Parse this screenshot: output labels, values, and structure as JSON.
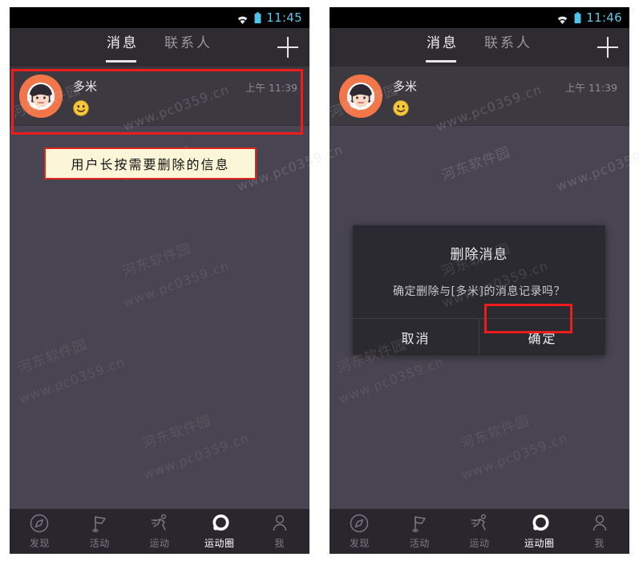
{
  "app": {
    "background_color": "#484451",
    "header_color": "#2e2b31",
    "accent_highlight_color": "#ee1d1d",
    "status_time_color": "#5ec8e8"
  },
  "panels": [
    {
      "id": "left",
      "statusbar": {
        "time": "11:45",
        "wifi_icon": "wifi-icon",
        "battery_icon": "battery-icon"
      },
      "header": {
        "tabs": [
          {
            "label": "消息",
            "active": true
          },
          {
            "label": "联系人",
            "active": false
          }
        ],
        "add_button": "+"
      },
      "messages": [
        {
          "avatar_icon": "avatar-support-girl-icon",
          "name": "多米",
          "preview_icon": "smiley-emoji-icon",
          "time": "上午 11:39"
        }
      ],
      "annotation": {
        "text": "用户长按需要删除的信息",
        "border_color": "#e2231a",
        "background_color": "#fcf6d8"
      },
      "highlight": {
        "target": "message-row"
      },
      "dialog": null
    },
    {
      "id": "right",
      "statusbar": {
        "time": "11:46",
        "wifi_icon": "wifi-icon",
        "battery_icon": "battery-icon"
      },
      "header": {
        "tabs": [
          {
            "label": "消息",
            "active": true
          },
          {
            "label": "联系人",
            "active": false
          }
        ],
        "add_button": "+"
      },
      "messages": [
        {
          "avatar_icon": "avatar-support-girl-icon",
          "name": "多米",
          "preview_icon": "smiley-emoji-icon",
          "time": "上午 11:39"
        }
      ],
      "annotation": null,
      "highlight": {
        "target": "confirm-button"
      },
      "dialog": {
        "title": "删除消息",
        "message": "确定删除与[多米]的消息记录吗？",
        "cancel_label": "取消",
        "confirm_label": "确定"
      }
    }
  ],
  "bottom_nav": {
    "items": [
      {
        "label": "发现",
        "icon": "compass-icon",
        "active": false
      },
      {
        "label": "活动",
        "icon": "flag-icon",
        "active": false
      },
      {
        "label": "运动",
        "icon": "running-icon",
        "active": false
      },
      {
        "label": "运动圈",
        "icon": "circle-dot-icon",
        "active": true
      },
      {
        "label": "我",
        "icon": "person-icon",
        "active": false
      }
    ]
  },
  "watermark": {
    "line_cn": "河东软件园",
    "line_url": "www.pc0359.cn"
  }
}
